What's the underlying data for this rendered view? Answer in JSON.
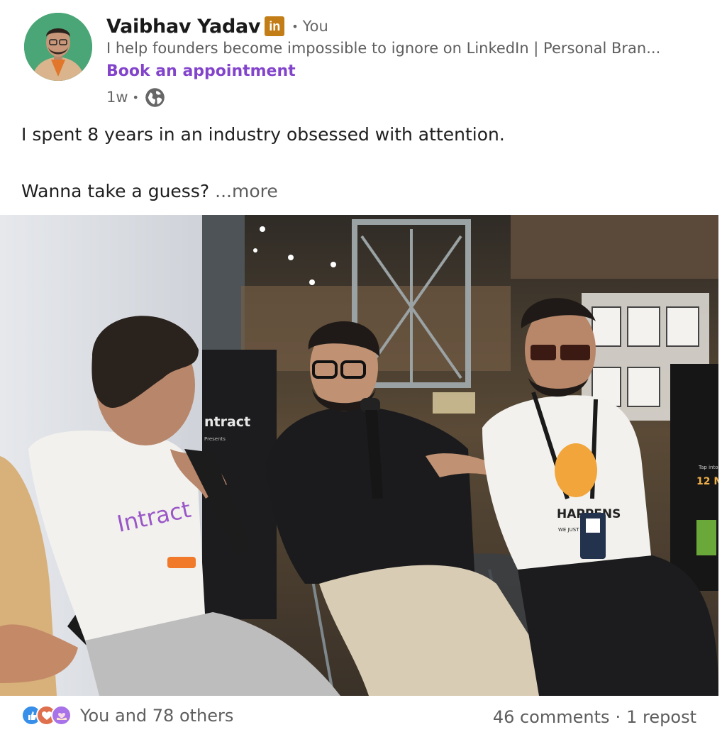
{
  "post": {
    "author": {
      "name": "Vaibhav Yadav",
      "badge": "in",
      "relation": "You",
      "headline": "I help founders become impossible to ignore on LinkedIn | Personal Bran...",
      "cta": "Book an appointment",
      "age": "1w",
      "visibility_icon": "globe-icon"
    },
    "body": {
      "line1": "I spent 8 years in an industry obsessed with attention.",
      "line2": "Wanna take a guess?",
      "more": "...more"
    },
    "image": {
      "sign_text": "ntract",
      "sign_sub": "Presents",
      "shirt_text": "Intract",
      "shirt2_text": "HAPPENS",
      "shirt2_sub": "WE JUST",
      "screen_text": "12 M",
      "screen_sub": "Tap into"
    },
    "social": {
      "reaction_icons": [
        "like-icon",
        "love-icon",
        "support-icon"
      ],
      "reactions_text": "You and 78 others",
      "comments": "46 comments",
      "separator": "·",
      "reposts": "1 repost"
    }
  },
  "colors": {
    "badge": "#c37d16",
    "cta": "#8344cc",
    "muted": "#5e5e5e",
    "like": "#378fe9",
    "love": "#df704d",
    "support": "#a872e8"
  }
}
